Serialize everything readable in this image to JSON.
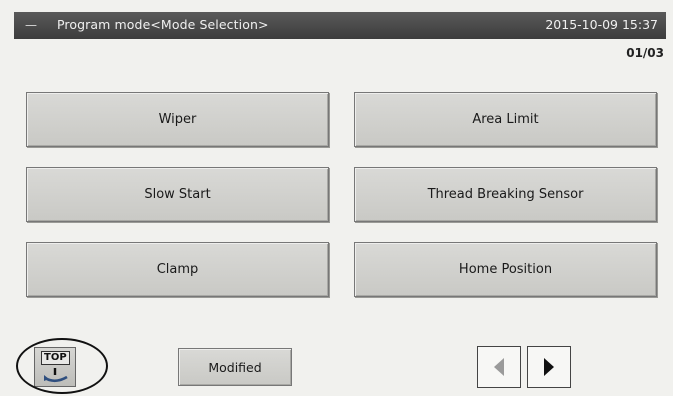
{
  "header": {
    "menu_glyph": "—",
    "title": "Program mode<Mode Selection>",
    "datetime": "2015-10-09 15:37"
  },
  "page_indicator": "01/03",
  "mode_buttons": [
    {
      "label": "Wiper"
    },
    {
      "label": "Area Limit"
    },
    {
      "label": "Slow Start"
    },
    {
      "label": "Thread Breaking Sensor"
    },
    {
      "label": "Clamp"
    },
    {
      "label": "Home Position"
    }
  ],
  "footer": {
    "top_button_label": "TOP",
    "modified_label": "Modified"
  },
  "icons": {
    "top": "home-return-icon",
    "prev": "triangle-left-icon",
    "next": "triangle-right-icon"
  },
  "colors": {
    "titlebar": "#4a4a4a",
    "button_face": "#d2d2ce",
    "screen_bg": "#f1f1ee",
    "prev_arrow_disabled": "#9a9a9a",
    "next_arrow": "#111111"
  }
}
